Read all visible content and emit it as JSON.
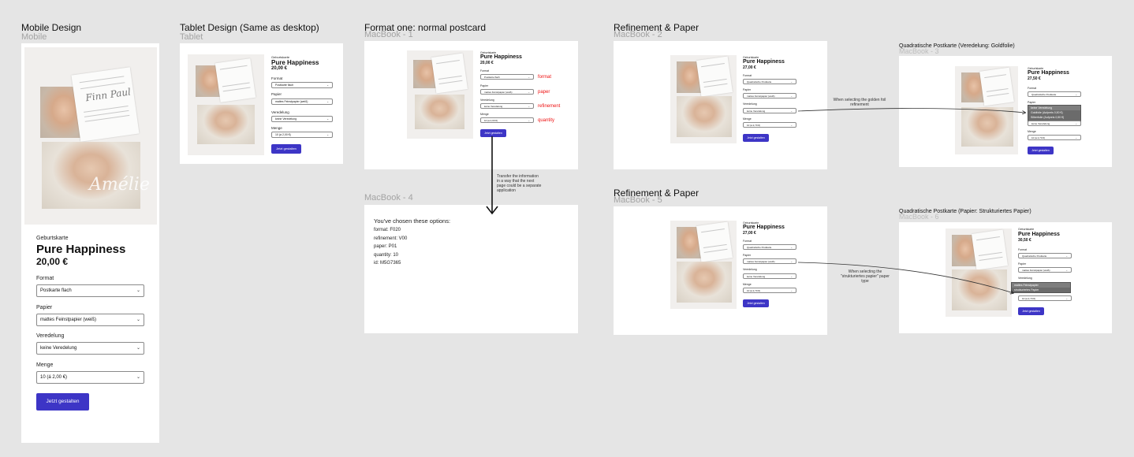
{
  "frames": {
    "mobile": {
      "title": "Mobile Design",
      "sub": "Mobile"
    },
    "tablet": {
      "title": "Tablet Design (Same as desktop)",
      "sub": "Tablet"
    },
    "f1": {
      "title": "Format one: normal postcard",
      "sub": "MacBook - 1"
    },
    "f2": {
      "title": "Refinement & Paper",
      "sub": "MacBook - 2"
    },
    "f3": {
      "title": "Quadratische Postkarte  (Veredelung: Goldfolie)",
      "sub": "MacBook - 3"
    },
    "f4": {
      "title": "",
      "sub": "MacBook - 4"
    },
    "f5": {
      "title": "Refinement & Paper",
      "sub": "MacBook - 5"
    },
    "f6": {
      "title": "Quadratische Postkarte  (Papier: Strukturiertes Papier)",
      "sub": "MacBook - 6"
    }
  },
  "product": {
    "eyebrow": "Geburtskarte",
    "name": "Pure Happiness",
    "price_a": "20,00 €",
    "price_b": "27,00 €",
    "price_c": "27,50 €",
    "price_d": "30,50 €",
    "card_script": "Amélie",
    "note_script": "Finn Paul",
    "labels": {
      "format": "Format",
      "paper": "Papier",
      "refinement": "Veredelung",
      "qty": "Menge"
    },
    "values": {
      "format": "Postkarte flach",
      "format_sq": "Quadratische Postkarte",
      "paper": "mattes Feinstpapier (weiß)",
      "paper_structured": "mattes Feinstpapier (weiß)",
      "refinement": "keine Veredelung",
      "qty": "10 (á 2,00 €)",
      "qty_sq": "10 (á 2,70 €)"
    },
    "button": "Jetzt gestalten"
  },
  "annotations": {
    "format": "format",
    "paper": "paper",
    "refinement": "refinement",
    "quantity": "quantity",
    "transfer": "Transfer the information in a way that the next page could be a separate application",
    "goldfoil": "When selecting the golden foil refinement",
    "structured": "When selecting the \"strukturiertes papier\" paper type"
  },
  "summary": {
    "heading": "You've chosen these options:",
    "lines": [
      "format: F020",
      "refinement: V00",
      "paper: P01",
      "quantity: 10",
      "id: M5G7365"
    ]
  },
  "dropdown_gold": [
    "keine Veredelung",
    "Goldfolie (Aufpreis 0,50 €)",
    "Silberfolie (Aufpreis 0,50 €)",
    "Roségoldfolie (Aufpreis 0,50 €)"
  ],
  "dropdown_paper": [
    "mattes Feinstpapier",
    "strukturiertes Papier"
  ],
  "colors": {
    "button": "#3d35c6",
    "annotation_red": "#ee1111",
    "canvas": "#e5e5e5"
  }
}
